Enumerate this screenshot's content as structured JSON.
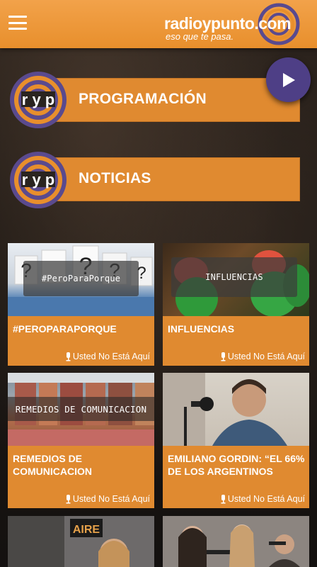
{
  "header": {
    "logo_word": "radioypunto.com",
    "logo_tagline": "eso que te pasa."
  },
  "sections": [
    {
      "label": "PROGRAMACIÓN"
    },
    {
      "label": "NOTICIAS"
    }
  ],
  "cards": [
    {
      "title": "#PEROPARAPORQUE",
      "overlay": "#PeroParaPorque",
      "meta": "Usted No Está Aquí"
    },
    {
      "title": "INFLUENCIAS",
      "overlay": "INFLUENCIAS",
      "meta": "Usted No Está Aquí"
    },
    {
      "title": "REMEDIOS DE COMUNICACION",
      "overlay": "REMEDIOS DE COMUNICACION",
      "meta": "Usted No Está Aquí"
    },
    {
      "title": "EMILIANO GORDIN: “EL 66% DE LOS ARGENTINOS",
      "meta": "Usted No Está Aquí"
    }
  ],
  "fifth_card": {
    "sign": "AIRE"
  },
  "colors": {
    "accent": "#e08a30",
    "topbar": "#ee9a3c",
    "play": "#4e3f86",
    "badge_purple": "#5a4a8e"
  },
  "icons": [
    "menu-icon",
    "play-icon",
    "microphone-icon"
  ]
}
